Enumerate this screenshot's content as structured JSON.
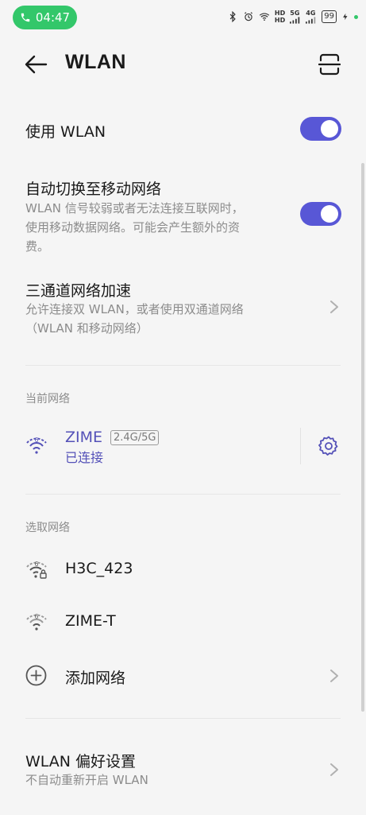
{
  "status_bar": {
    "time": "04:47",
    "hd_top": "HD",
    "hd_bottom": "HD",
    "net_5g": "5G",
    "net_4g": "4G",
    "battery": "99"
  },
  "header": {
    "title": "WLAN"
  },
  "use_wlan": {
    "label": "使用 WLAN",
    "enabled": true
  },
  "auto_switch": {
    "title": "自动切换至移动网络",
    "desc_line1": "WLAN 信号较弱或者无法连接互联网时，",
    "desc_line2": "使用移动数据网络。可能会产生额外的资",
    "desc_line3": "费。",
    "enabled": true
  },
  "tri_channel": {
    "title": "三通道网络加速",
    "desc_line1": "允许连接双 WLAN，或者使用双通道网络",
    "desc_line2": "（WLAN 和移动网络）"
  },
  "current_network": {
    "section_label": "当前网络",
    "name": "ZIME",
    "band": "2.4G/5G",
    "status": "已连接",
    "wifi_badge": "6"
  },
  "available_networks": {
    "section_label": "选取网络",
    "items": [
      {
        "name": "H3C_423",
        "badge": "6",
        "secured": true
      },
      {
        "name": "ZIME-T",
        "badge": "6",
        "secured": false
      }
    ],
    "add_label": "添加网络"
  },
  "preferences": {
    "title": "WLAN 偏好设置",
    "desc": "不自动重新开启 WLAN"
  },
  "colors": {
    "accent": "#5857d6",
    "time_pill": "#33c76a",
    "connected": "#5451b8"
  }
}
